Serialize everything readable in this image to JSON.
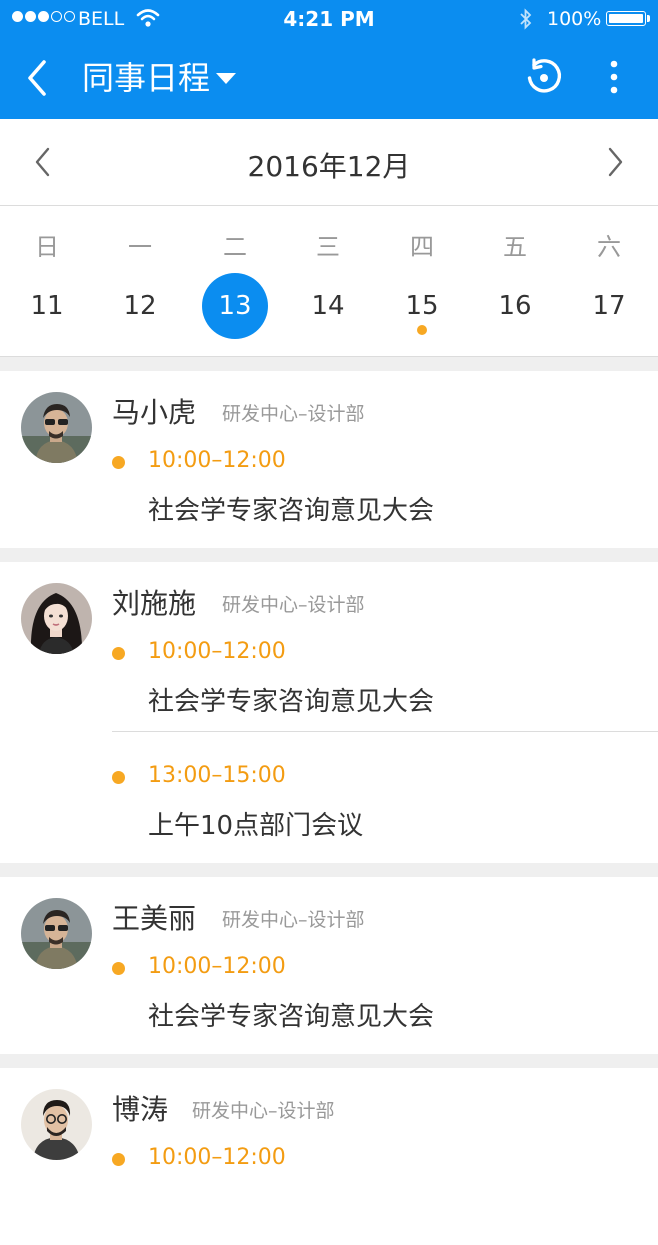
{
  "status_bar": {
    "carrier": "BELL",
    "time": "4:21 PM",
    "battery": "100%"
  },
  "nav": {
    "title": "同事日程"
  },
  "calendar": {
    "month_label": "2016年12月",
    "weekdays": [
      "日",
      "一",
      "二",
      "三",
      "四",
      "五",
      "六"
    ],
    "days": [
      "11",
      "12",
      "13",
      "14",
      "15",
      "16",
      "17"
    ],
    "selected_index": 2,
    "event_indicator_index": 4
  },
  "schedules": [
    {
      "name": "马小虎",
      "dept": "研发中心–设计部",
      "events": [
        {
          "time": "10:00–12:00",
          "title": "社会学专家咨询意见大会"
        }
      ]
    },
    {
      "name": "刘施施",
      "dept": "研发中心–设计部",
      "events": [
        {
          "time": "10:00–12:00",
          "title": "社会学专家咨询意见大会"
        },
        {
          "time": "13:00–15:00",
          "title": "上午10点部门会议"
        }
      ]
    },
    {
      "name": "王美丽",
      "dept": "研发中心–设计部",
      "events": [
        {
          "time": "10:00–12:00",
          "title": "社会学专家咨询意见大会"
        }
      ]
    },
    {
      "name": "博涛",
      "dept": "研发中心–设计部",
      "events": [
        {
          "time": "10:00–12:00",
          "title": ""
        }
      ]
    }
  ],
  "colors": {
    "primary": "#0b8df0",
    "accent": "#f7a823",
    "time_text": "#f39c12"
  }
}
